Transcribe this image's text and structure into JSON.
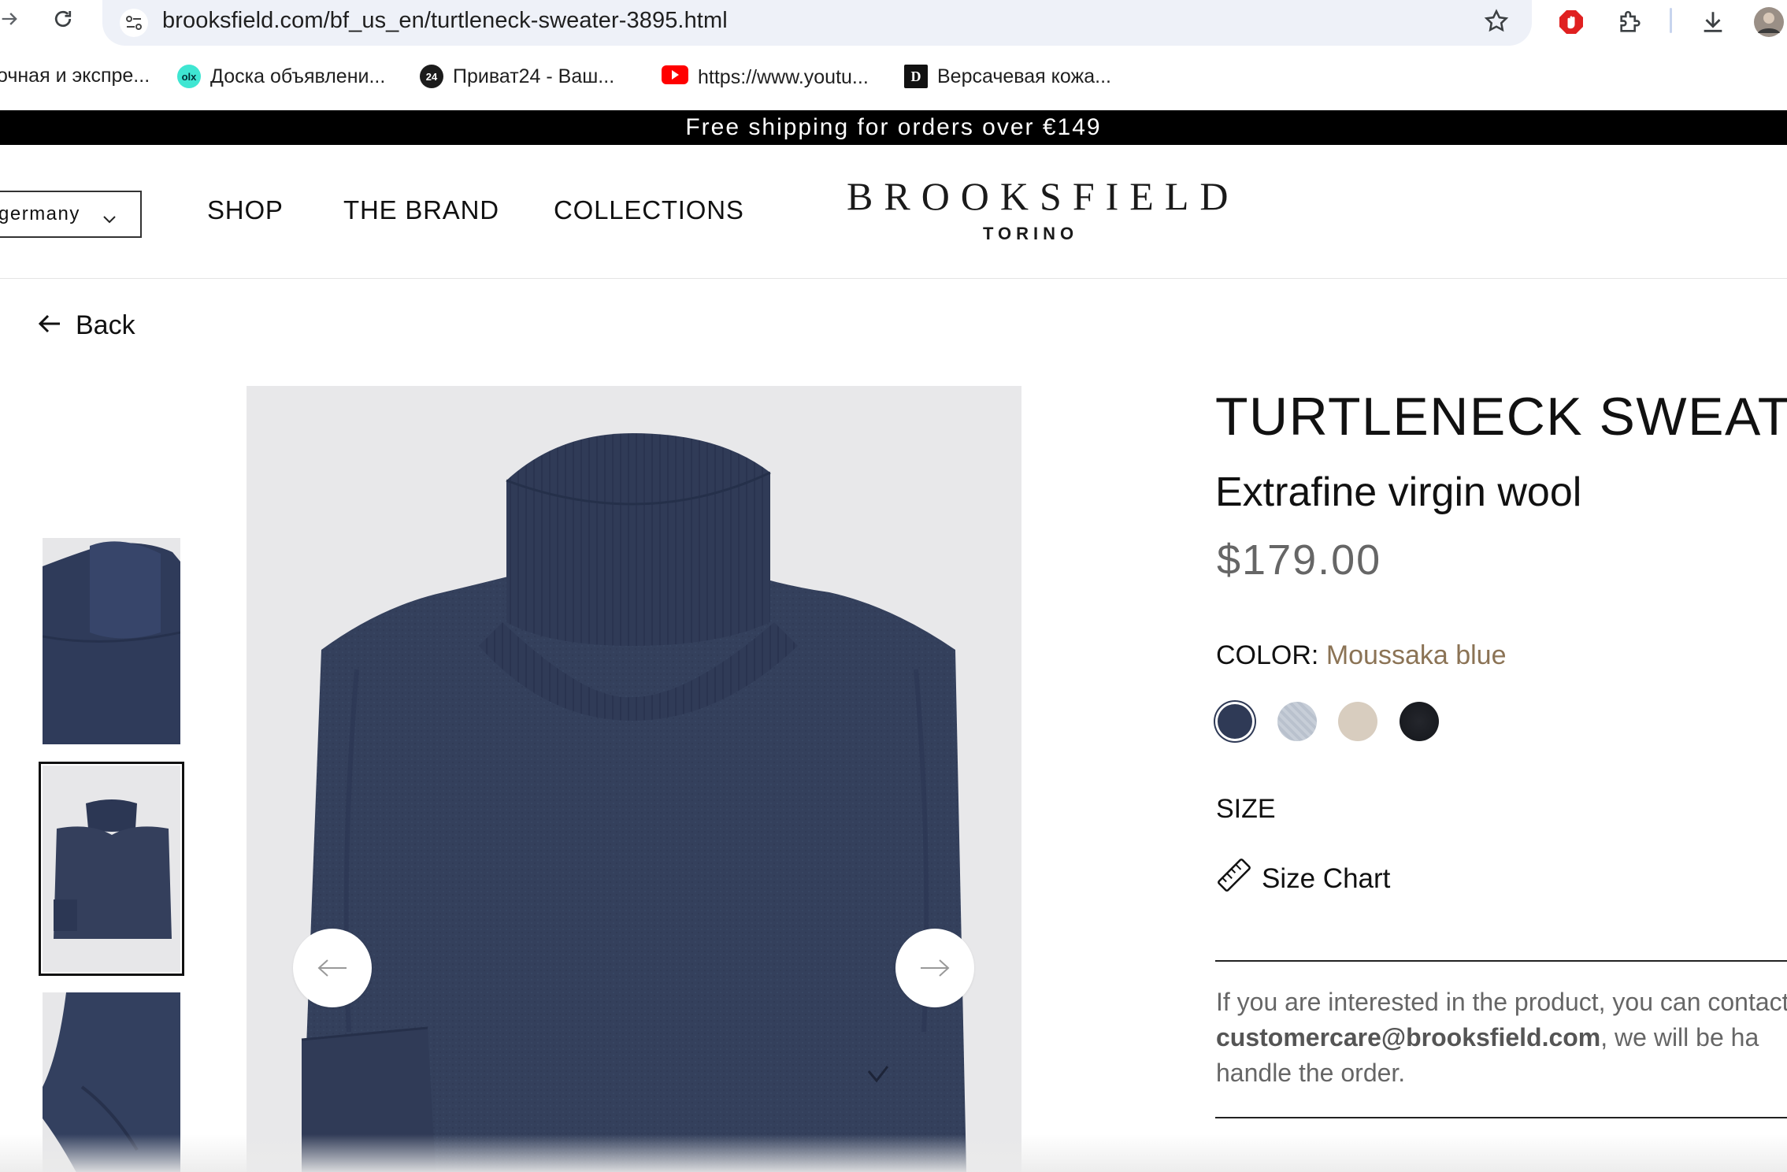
{
  "browser": {
    "url": "brooksfield.com/bf_us_en/turtleneck-sweater-3895.html",
    "bookmarks": [
      {
        "label": "очная и экспре...",
        "icon": "cut-off-icon"
      },
      {
        "label": "Доска объявлени...",
        "icon": "olx-icon",
        "icon_text": "olx"
      },
      {
        "label": "Приват24 - Ваш...",
        "icon": "privat24-icon",
        "icon_text": "24"
      },
      {
        "label": "https://www.youtu...",
        "icon": "youtube-icon"
      },
      {
        "label": "Версачевая кожа...",
        "icon": "d-logo-icon",
        "icon_text": "D"
      }
    ]
  },
  "promo": {
    "text": "Free shipping for orders over €149"
  },
  "header": {
    "country": "germany",
    "menu": [
      "SHOP",
      "THE BRAND",
      "COLLECTIONS"
    ],
    "logo": {
      "main": "BROOKSFIELD",
      "sub": "TORINO"
    }
  },
  "back": {
    "label": "Back"
  },
  "product": {
    "title": "TURTLENECK SWEATER",
    "subtitle": "Extrafine virgin wool",
    "price": "$179.00",
    "color_label": "COLOR:",
    "color_value": "Moussaka blue",
    "swatches": [
      {
        "name": "moussaka-blue",
        "color": "#2f3a56",
        "selected": true
      },
      {
        "name": "light-blue",
        "color": "#c5ccd6",
        "selected": false
      },
      {
        "name": "beige",
        "color": "#d8cdbf",
        "selected": false
      },
      {
        "name": "black",
        "color": "#1a1c22",
        "selected": false
      }
    ],
    "size_label": "SIZE",
    "size_chart_label": "Size Chart",
    "contact_line1": "If you are interested in the product, you can contact",
    "contact_email": "customercare@brooksfield.com",
    "contact_line2_rest": ", we will be ha",
    "contact_line3": "handle the order."
  },
  "colors": {
    "promo_bg": "#000000",
    "sweater": "#34405c",
    "image_bg": "#e8e8ea",
    "accent_color_value": "#8b7355",
    "price": "#666666"
  }
}
